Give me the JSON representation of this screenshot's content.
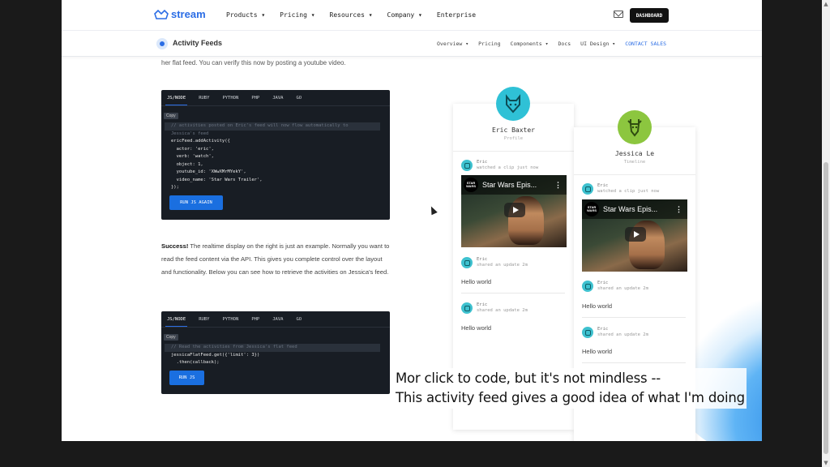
{
  "nav": {
    "brand": "stream",
    "menu": [
      "Products ▾",
      "Pricing ▾",
      "Resources ▾",
      "Company ▾",
      "Enterprise"
    ],
    "dashboard_label": "DASHBOARD"
  },
  "subnav": {
    "title": "Activity Feeds",
    "menu": [
      "Overview ▾",
      "Pricing",
      "Components ▾",
      "Docs",
      "UI Design ▾"
    ],
    "contact_label": "CONTACT SALES"
  },
  "intro_text": "her flat feed. You can verify this now by posting a youtube video.",
  "code1": {
    "tabs": [
      "JS/NODE",
      "RUBY",
      "PYTHON",
      "PHP",
      "JAVA",
      "GO"
    ],
    "copy_label": "Copy",
    "comment_line1": "// activities posted on Eric's feed will now flow automatically to",
    "comment_line2": "Jessica's feed",
    "lines": [
      "ericFeed.addActivity({",
      "  actor: 'eric',",
      "  verb: 'watch',",
      "  object: 1,",
      "  youtube_id: 'XWwXMrMYekY',",
      "  video_name: 'Star Wars Trailer',",
      "});"
    ],
    "button_label": "RUN JS AGAIN"
  },
  "success": {
    "bold": "Success!",
    "text": " The realtime display on the right is just an example. Normally you want to read the feed content via the API. This gives you complete control over the layout and functionality. Below you can see how to retrieve the activities on Jessica's feed."
  },
  "code2": {
    "tabs": [
      "JS/NODE",
      "RUBY",
      "PYTHON",
      "PHP",
      "JAVA",
      "GO"
    ],
    "copy_label": "Copy",
    "comment_line": "// Read the activities from Jessica's flat feed",
    "lines": [
      "jessicaFlatFeed.get({'limit': 3})",
      "  .then(callback);"
    ],
    "button_label": "RUN JS"
  },
  "card_eric": {
    "name": "Eric Baxter",
    "sub": "Profile",
    "items": [
      {
        "who": "Eric",
        "what": "watched a clip just now"
      },
      {
        "who": "Eric",
        "what": "shared an update 2m"
      },
      {
        "who": "Eric",
        "what": "shared an update 2m"
      }
    ],
    "video_title": "Star Wars Epis...",
    "hello1": "Hello world",
    "hello2": "Hello world"
  },
  "card_jessica": {
    "name": "Jessica Le",
    "sub": "Timeline",
    "items": [
      {
        "who": "Eric",
        "what": "watched a clip just now"
      },
      {
        "who": "Eric",
        "what": "shared an update 2m"
      },
      {
        "who": "Eric",
        "what": "shared an update 2m"
      }
    ],
    "video_title": "Star Wars Epis...",
    "hello1": "Hello world",
    "hello2": "Hello world"
  },
  "caption": {
    "line1": "Mor click to code, but it's not mindless --",
    "line2": "This activity feed gives a good idea of what I'm doing"
  },
  "colors": {
    "brand": "#2b6de5",
    "code_bg": "#181d24",
    "teal_avatar": "#2fc1d6",
    "green_avatar": "#8cc63f"
  }
}
